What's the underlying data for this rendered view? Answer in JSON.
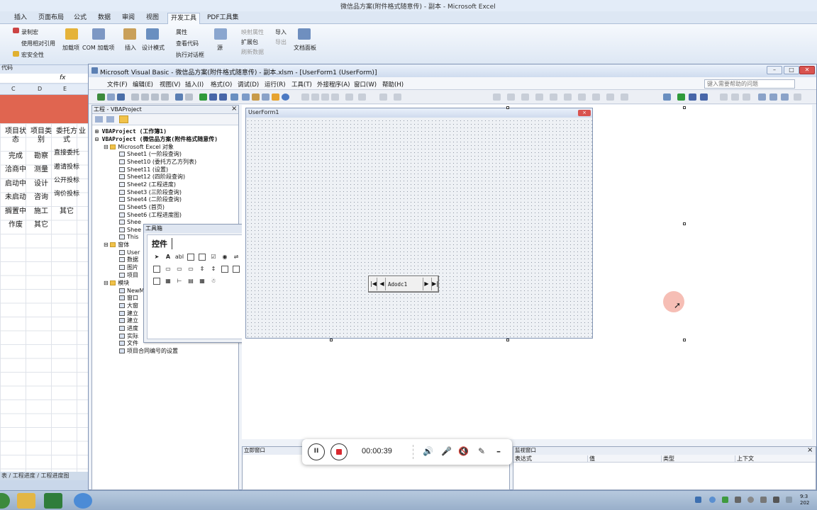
{
  "excel": {
    "title": "微信品方案(附件格式随意传) - 副本 - Microsoft Excel",
    "tabs": [
      "插入",
      "页面布局",
      "公式",
      "数据",
      "审阅",
      "视图",
      "开发工具",
      "PDF工具集"
    ],
    "active_tab": "开发工具",
    "ribbon": {
      "record_macro": "录制宏",
      "relative_ref": "使用相对引用",
      "macro_security": "宏安全性",
      "code_group": "代码",
      "addins": "加载项",
      "com_addins": "COM 加载项",
      "insert": "插入",
      "design_mode": "设计模式",
      "properties": "属性",
      "view_code": "查看代码",
      "run_dialog": "执行对话框",
      "source": "源",
      "map_props": "映射属性",
      "expansion_pack": "扩展包",
      "refresh_data": "刷新数据",
      "import": "导入",
      "export": "导出",
      "doc_panel": "文档面板"
    },
    "fx_label": "fx",
    "columns": [
      "C",
      "D",
      "E"
    ],
    "header_row": [
      "项目状态",
      "项目类别",
      "委托方式",
      "业"
    ],
    "rows": [
      [
        "完成",
        "勘察",
        "直接委托"
      ],
      [
        "洽商中",
        "测量",
        "邀请投标"
      ],
      [
        "启动中",
        "设计",
        "公开投标"
      ],
      [
        "未启动",
        "咨询",
        "询价投标"
      ],
      [
        "搁置中",
        "施工",
        "其它"
      ],
      [
        "作废",
        "其它",
        ""
      ]
    ],
    "sheet_tabs": "表 / 工程进度 / 工程进度图"
  },
  "vbe": {
    "title": "Microsoft Visual Basic - 微信品方案(附件格式随意传) - 副本.xlsm - [UserForm1 (UserForm)]",
    "menu": [
      "文件(F)",
      "编辑(E)",
      "视图(V)",
      "插入(I)",
      "格式(O)",
      "调试(D)",
      "运行(R)",
      "工具(T)",
      "外接程序(A)",
      "窗口(W)",
      "帮助(H)"
    ],
    "help_placeholder": "键入需要帮助的问题",
    "project": {
      "title": "工程 - VBAProject",
      "close": "×",
      "items": [
        "VBAProject (工作簿1)",
        "VBAProject (微信品方案(附件格式随意传)",
        "Microsoft Excel 对象",
        "Sheet1 (一阶段查询)",
        "Sheet10 (委托方乙方列表)",
        "Sheet11 (设置)",
        "Sheet12 (四阶段查询)",
        "Sheet2 (工程进度)",
        "Sheet3 (三阶段查询)",
        "Sheet4 (二阶段查询)",
        "Sheet5 (首页)",
        "Sheet6 (工程进度图)",
        "Shee",
        "Shee",
        "This",
        "窗体",
        "User",
        "数据",
        "图片",
        "项目",
        "模块",
        "NewM",
        "窗口",
        "大窗",
        "建立",
        "建立",
        "进度",
        "实际",
        "文件",
        "项目合同编号的设置"
      ]
    },
    "toolbox": {
      "title": "工具箱",
      "tab": "控件",
      "close": "×"
    },
    "userform": {
      "title": "UserForm1",
      "close": "×"
    },
    "adodc": {
      "caption": "Adodc1",
      "first": "|◀",
      "prev": "◀",
      "next": "▶",
      "last": "▶|"
    },
    "immediate": {
      "title": "立即窗口"
    },
    "watch": {
      "title": "监视窗口",
      "close": "×",
      "columns": [
        "表达式",
        "值",
        "类型",
        "上下文"
      ]
    }
  },
  "recorder": {
    "time": "00:00:39",
    "pause": "II"
  },
  "taskbar": {
    "clock": "9:3",
    "date": "202"
  }
}
